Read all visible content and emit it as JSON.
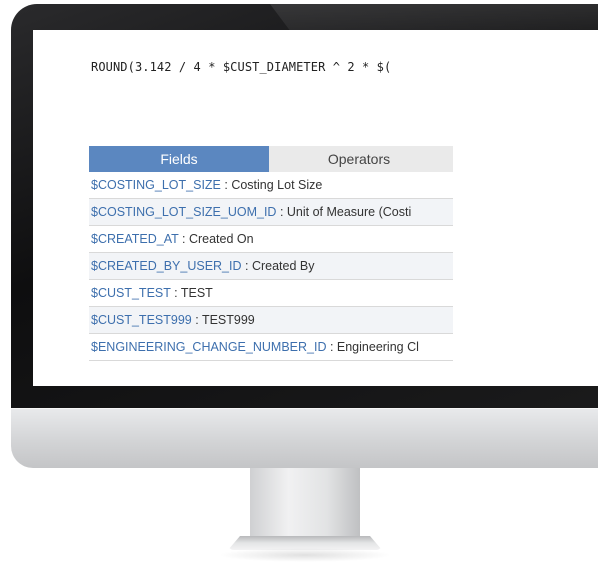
{
  "formula": {
    "text": "ROUND(3.142 / 4 * $CUST_DIAMETER ^ 2 * $("
  },
  "tabs": {
    "fields_label": "Fields",
    "operators_label": "Operators"
  },
  "fields": [
    {
      "code": "$COSTING_LOT_SIZE",
      "sep": " : ",
      "desc": "Costing Lot Size"
    },
    {
      "code": "$COSTING_LOT_SIZE_UOM_ID",
      "sep": " : ",
      "desc": "Unit of Measure (Costi"
    },
    {
      "code": "$CREATED_AT",
      "sep": " : ",
      "desc": "Created On"
    },
    {
      "code": "$CREATED_BY_USER_ID",
      "sep": " : ",
      "desc": "Created By"
    },
    {
      "code": "$CUST_TEST",
      "sep": " : ",
      "desc": "TEST"
    },
    {
      "code": "$CUST_TEST999",
      "sep": " : ",
      "desc": "TEST999"
    },
    {
      "code": "$ENGINEERING_CHANGE_NUMBER_ID",
      "sep": " : ",
      "desc": "Engineering Cl"
    }
  ],
  "colors": {
    "tab_active": "#5b87c0",
    "field_code": "#3d6fad",
    "bezel": "#111111",
    "chin": "#d3d4d6"
  },
  "icons": {
    "monitor": "monitor-icon"
  }
}
